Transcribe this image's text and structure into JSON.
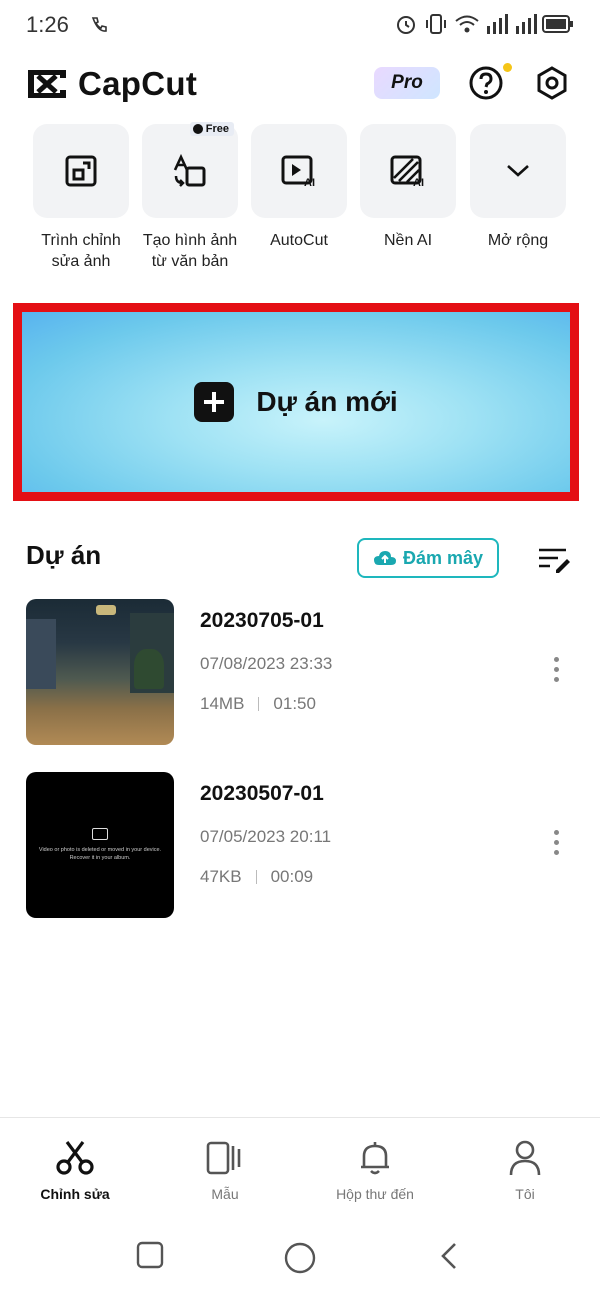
{
  "status_bar": {
    "time": "1:26"
  },
  "header": {
    "app_name": "CapCut",
    "pro_label": "Pro"
  },
  "tools": [
    {
      "label_line1": "Trình chỉnh",
      "label_line2": "sửa ảnh",
      "icon": "photo-edit-icon"
    },
    {
      "label_line1": "Tạo hình ảnh",
      "label_line2": "từ văn bản",
      "icon": "text-to-image-icon",
      "badge": "Free"
    },
    {
      "label_line1": "AutoCut",
      "label_line2": "",
      "icon": "autocut-ai-icon"
    },
    {
      "label_line1": "Nền AI",
      "label_line2": "",
      "icon": "ai-background-icon"
    },
    {
      "label_line1": "Mở rộng",
      "label_line2": "",
      "icon": "chevron-down-icon"
    }
  ],
  "new_project": {
    "label": "Dự án mới"
  },
  "projects_section": {
    "title": "Dự án",
    "cloud_label": "Đám mây"
  },
  "projects": [
    {
      "name": "20230705-01",
      "date": "07/08/2023 23:33",
      "size": "14MB",
      "duration": "01:50"
    },
    {
      "name": "20230507-01",
      "date": "07/05/2023 20:11",
      "size": "47KB",
      "duration": "00:09",
      "thumb_message": "Video or photo is deleted or moved in your device. Recover it in your album."
    }
  ],
  "bottom_nav": [
    {
      "label": "Chỉnh sửa",
      "icon": "scissors-icon",
      "active": true
    },
    {
      "label": "Mẫu",
      "icon": "template-icon",
      "active": false
    },
    {
      "label": "Hộp thư đến",
      "icon": "bell-icon",
      "active": false
    },
    {
      "label": "Tôi",
      "icon": "user-icon",
      "active": false
    }
  ],
  "colors": {
    "accent": "#1eb7bd",
    "highlight_border": "#e40f14",
    "pro_dot": "#f5c518"
  }
}
